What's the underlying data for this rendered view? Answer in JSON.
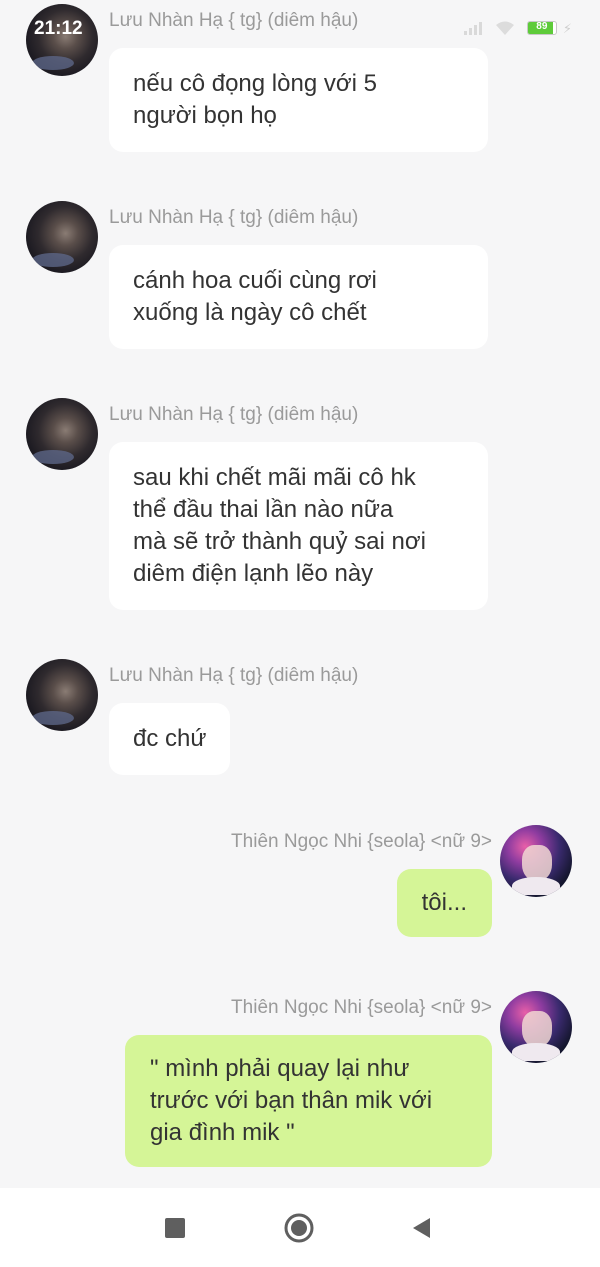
{
  "status_bar": {
    "time": "21:12",
    "battery_level": "89",
    "battery_fraction": 0.89,
    "icons": [
      "signal-icon",
      "wifi-icon",
      "battery-icon",
      "charging-bolt-icon"
    ]
  },
  "messages": [
    {
      "side": "left",
      "sender": "Lưu Nhàn Hạ { tg} (diêm hậu)",
      "lines": [
        "nếu cô đọng lòng với 5",
        "người bọn họ"
      ]
    },
    {
      "side": "left",
      "sender": "Lưu Nhàn Hạ { tg} (diêm hậu)",
      "lines": [
        "cánh hoa cuối cùng rơi",
        "xuống là ngày cô chết"
      ]
    },
    {
      "side": "left",
      "sender": "Lưu Nhàn Hạ { tg} (diêm hậu)",
      "lines": [
        "sau khi chết mãi mãi cô hk",
        "thể đầu thai lần nào nữa",
        "mà sẽ trở thành quỷ sai nơi",
        "diêm điện lạnh lẽo này"
      ]
    },
    {
      "side": "left",
      "sender": "Lưu Nhàn Hạ { tg} (diêm hậu)",
      "lines": [
        "đc chứ"
      ]
    },
    {
      "side": "right",
      "sender": "Thiên Ngọc Nhi {seola} <nữ 9>",
      "lines": [
        "tôi..."
      ]
    },
    {
      "side": "right",
      "sender": "Thiên Ngọc Nhi {seola} <nữ 9>",
      "lines": [
        "\" mình phải quay lại như",
        "trước với bạn thân mik với",
        "gia đình mik \""
      ]
    }
  ],
  "nav_bar": {
    "icons": [
      "recent-apps-icon",
      "home-icon",
      "back-icon"
    ]
  },
  "colors": {
    "background": "#f6f6f7",
    "left_bubble": "#ffffff",
    "right_bubble": "#d5f597",
    "sender_text": "#9a9a9a",
    "battery_green": "#5ecb3a"
  }
}
